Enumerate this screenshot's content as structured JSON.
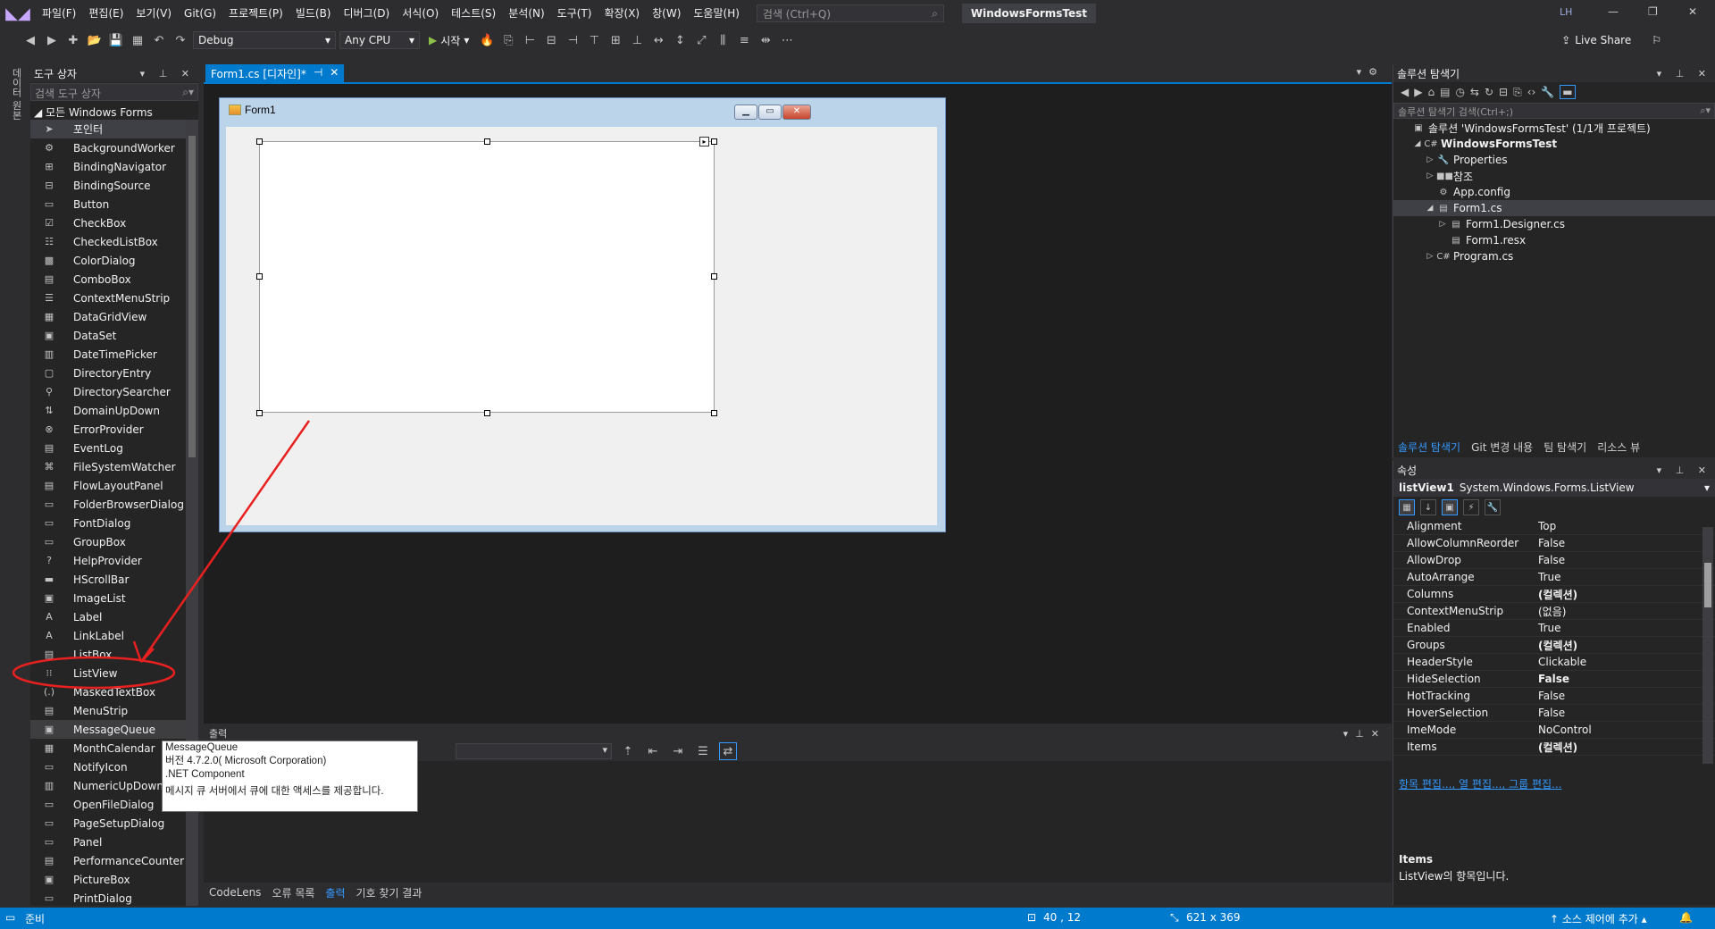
{
  "menu": {
    "items": [
      "파일(F)",
      "편집(E)",
      "보기(V)",
      "Git(G)",
      "프로젝트(P)",
      "빌드(B)",
      "디버그(D)",
      "서식(O)",
      "테스트(S)",
      "분석(N)",
      "도구(T)",
      "확장(X)",
      "창(W)",
      "도움말(H)"
    ],
    "search_placeholder": "검색 (Ctrl+Q)",
    "solution_name": "WindowsFormsTest",
    "user": "LH"
  },
  "toolbar": {
    "config": "Debug",
    "platform": "Any CPU",
    "start": "시작",
    "live_share": "Live Share"
  },
  "left_strip": {
    "label": "데이터 원본"
  },
  "toolbox": {
    "title": "도구 상자",
    "search_placeholder": "검색 도구 상자",
    "group": "모든 Windows Forms",
    "items": [
      "포인터",
      "BackgroundWorker",
      "BindingNavigator",
      "BindingSource",
      "Button",
      "CheckBox",
      "CheckedListBox",
      "ColorDialog",
      "ComboBox",
      "ContextMenuStrip",
      "DataGridView",
      "DataSet",
      "DateTimePicker",
      "DirectoryEntry",
      "DirectorySearcher",
      "DomainUpDown",
      "ErrorProvider",
      "EventLog",
      "FileSystemWatcher",
      "FlowLayoutPanel",
      "FolderBrowserDialog",
      "FontDialog",
      "GroupBox",
      "HelpProvider",
      "HScrollBar",
      "ImageList",
      "Label",
      "LinkLabel",
      "ListBox",
      "ListView",
      "MaskedTextBox",
      "MenuStrip",
      "MessageQueue",
      "MonthCalendar",
      "NotifyIcon",
      "NumericUpDown",
      "OpenFileDialog",
      "PageSetupDialog",
      "Panel",
      "PerformanceCounter",
      "PictureBox",
      "PrintDialog"
    ]
  },
  "editor": {
    "tab": "Form1.cs [디자인]*",
    "form_title": "Form1"
  },
  "tooltip": {
    "name": "MessageQueue",
    "version": "버전 4.7.2.0( Microsoft Corporation)",
    "kind": ".NET Component",
    "description": "메시지 큐 서버에서 큐에 대한 액세스를 제공합니다."
  },
  "output": {
    "title": "출력",
    "bottom_tabs": [
      "CodeLens",
      "오류 목록",
      "출력",
      "기호 찾기 결과"
    ]
  },
  "solution_explorer": {
    "title": "솔루션 탐색기",
    "search_placeholder": "솔루션 탐색기 검색(Ctrl+;)",
    "tree": [
      {
        "label": "솔루션 'WindowsFormsTest' (1/1개 프로젝트)"
      },
      {
        "label": "WindowsFormsTest"
      },
      {
        "label": "Properties"
      },
      {
        "label": "참조"
      },
      {
        "label": "App.config"
      },
      {
        "label": "Form1.cs"
      },
      {
        "label": "Form1.Designer.cs"
      },
      {
        "label": "Form1.resx"
      },
      {
        "label": "Program.cs"
      }
    ],
    "tabs": [
      "솔루션 탐색기",
      "Git 변경 내용",
      "팀 탐색기",
      "리소스 뷰"
    ]
  },
  "properties": {
    "title": "속성",
    "object_name": "listView1",
    "object_type": "System.Windows.Forms.ListView",
    "rows": [
      {
        "k": "Alignment",
        "v": "Top"
      },
      {
        "k": "AllowColumnReorder",
        "v": "False"
      },
      {
        "k": "AllowDrop",
        "v": "False"
      },
      {
        "k": "AutoArrange",
        "v": "True"
      },
      {
        "k": "Columns",
        "v": "(컬렉션)"
      },
      {
        "k": "ContextMenuStrip",
        "v": "(없음)"
      },
      {
        "k": "Enabled",
        "v": "True"
      },
      {
        "k": "Groups",
        "v": "(컬렉션)"
      },
      {
        "k": "HeaderStyle",
        "v": "Clickable"
      },
      {
        "k": "HideSelection",
        "v": "False"
      },
      {
        "k": "HotTracking",
        "v": "False"
      },
      {
        "k": "HoverSelection",
        "v": "False"
      },
      {
        "k": "ImeMode",
        "v": "NoControl"
      },
      {
        "k": "Items",
        "v": "(컬렉션)"
      }
    ],
    "links": "항목 편집..., 열 편집..., 그룹 편집...",
    "desc_title": "Items",
    "desc": "ListView의 항목입니다."
  },
  "status": {
    "ready": "준비",
    "position": "40 , 12",
    "size": "621 x 369",
    "source_control": "소스 제어에 추가"
  },
  "colors": {
    "accent": "#007acc",
    "annotation": "#e8201f"
  }
}
